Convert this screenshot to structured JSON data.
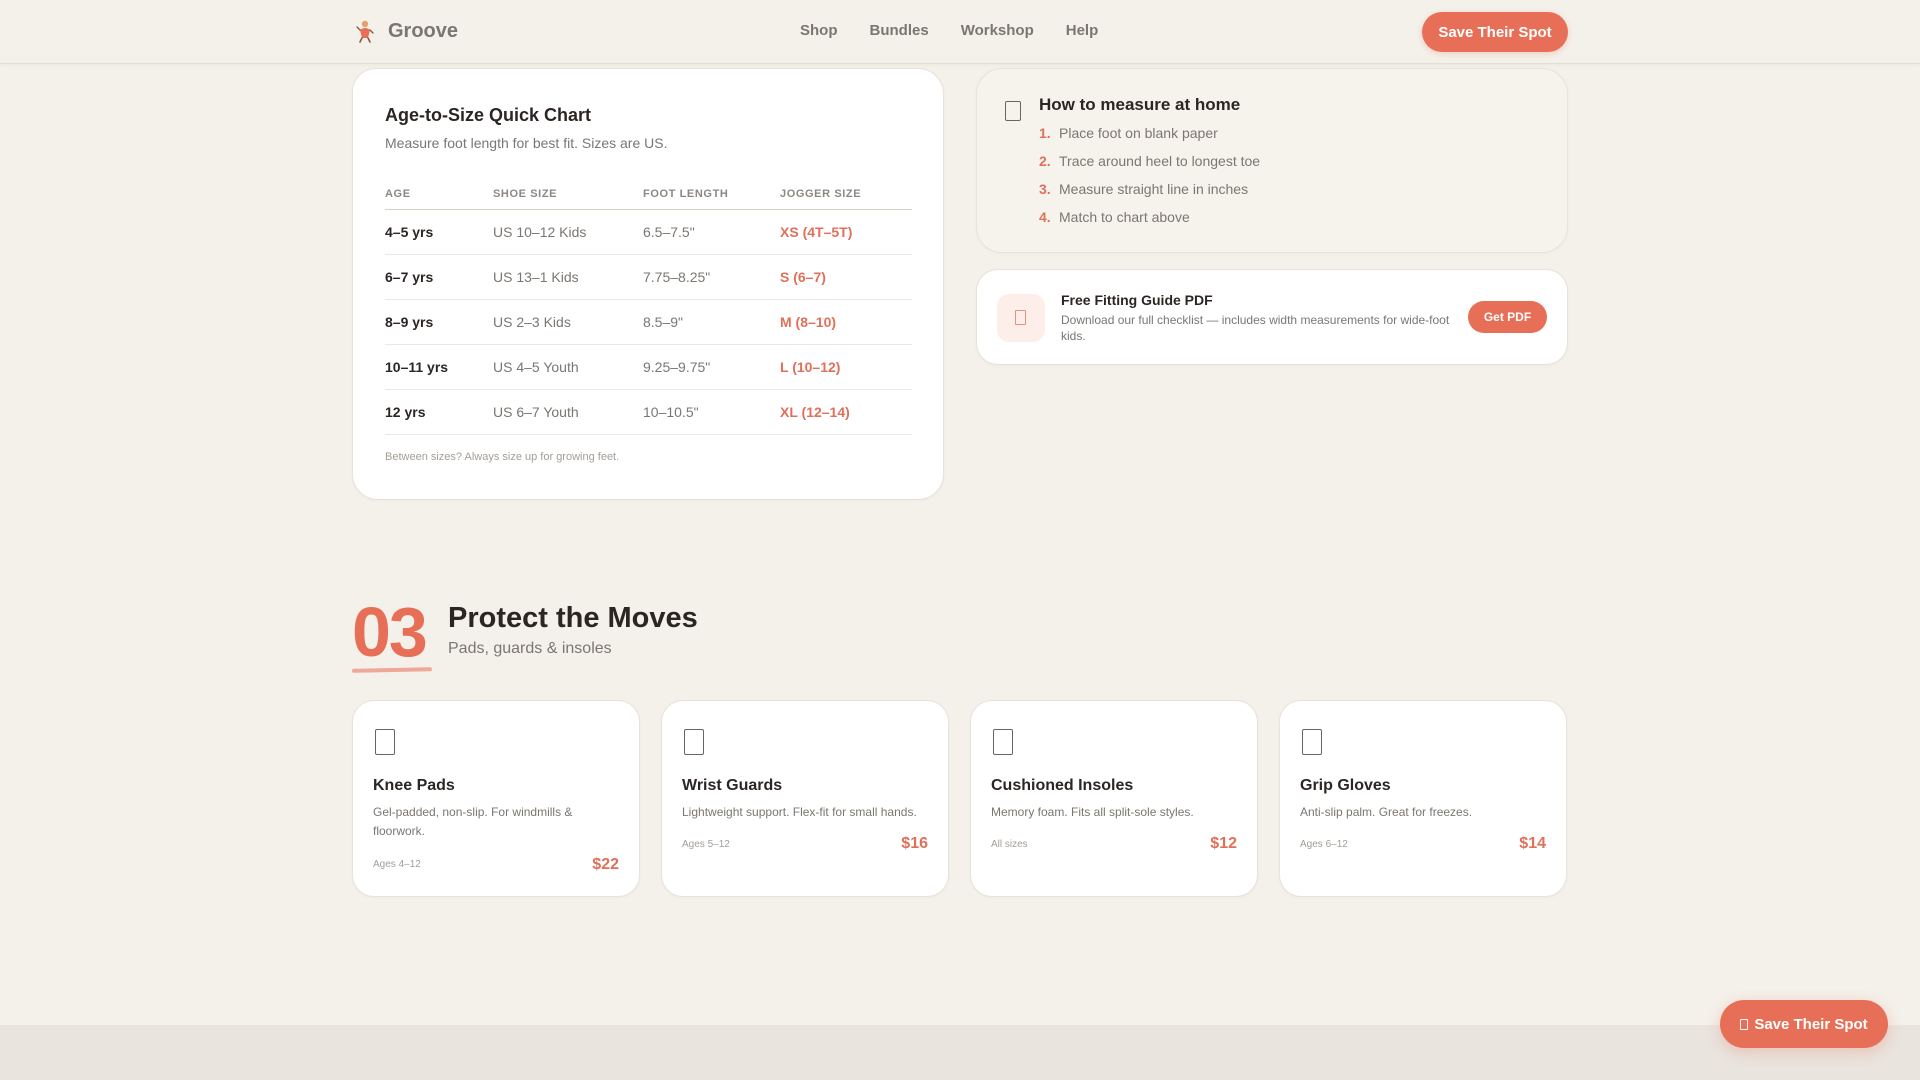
{
  "header": {
    "logo_text": "Groove",
    "logo_icon": "dancer-logo-icon",
    "nav": [
      "Shop",
      "Bundles",
      "Workshop",
      "Help"
    ],
    "cta_label": "Save Their Spot"
  },
  "size_chart": {
    "title": "Age-to-Size Quick Chart",
    "subtitle": "Measure foot length for best fit. Sizes are US.",
    "columns": [
      "AGE",
      "SHOE SIZE",
      "FOOT LENGTH",
      "JOGGER SIZE"
    ],
    "rows": [
      {
        "age": "4–5 yrs",
        "shoe": "US 10–12 Kids",
        "foot": "6.5–7.5\"",
        "jogger": "XS (4T–5T)"
      },
      {
        "age": "6–7 yrs",
        "shoe": "US 13–1 Kids",
        "foot": "7.75–8.25\"",
        "jogger": "S (6–7)"
      },
      {
        "age": "8–9 yrs",
        "shoe": "US 2–3 Kids",
        "foot": "8.5–9\"",
        "jogger": "M (8–10)"
      },
      {
        "age": "10–11 yrs",
        "shoe": "US 4–5 Youth",
        "foot": "9.25–9.75\"",
        "jogger": "L (10–12)"
      },
      {
        "age": "12 yrs",
        "shoe": "US 6–7 Youth",
        "foot": "10–10.5\"",
        "jogger": "XL (12–14)"
      }
    ],
    "note": "Between sizes? Always size up for growing feet."
  },
  "measure": {
    "title": "How to measure at home",
    "icon": "ruler-icon",
    "steps": [
      {
        "num": "1.",
        "text": "Place foot on blank paper"
      },
      {
        "num": "2.",
        "text": "Trace around heel to longest toe"
      },
      {
        "num": "3.",
        "text": "Measure straight line in inches"
      },
      {
        "num": "4.",
        "text": "Match to chart above"
      }
    ]
  },
  "pdf": {
    "title": "Free Fitting Guide PDF",
    "description": "Download our full checklist — includes width measurements for wide-foot kids.",
    "button_label": "Get PDF",
    "icon": "document-icon"
  },
  "section": {
    "number": "03",
    "title": "Protect the Moves",
    "subtitle": "Pads, guards & insoles"
  },
  "products": [
    {
      "name": "Knee Pads",
      "description": "Gel-padded, non-slip. For windmills & floorwork.",
      "ages": "Ages 4–12",
      "price": "$22",
      "icon": "knee-pad-icon"
    },
    {
      "name": "Wrist Guards",
      "description": "Lightweight support. Flex-fit for small hands.",
      "ages": "Ages 5–12",
      "price": "$16",
      "icon": "wrist-guard-icon"
    },
    {
      "name": "Cushioned Insoles",
      "description": "Memory foam. Fits all split-sole styles.",
      "ages": "All sizes",
      "price": "$12",
      "icon": "insole-icon"
    },
    {
      "name": "Grip Gloves",
      "description": "Anti-slip palm. Great for freezes.",
      "ages": "Ages 6–12",
      "price": "$14",
      "icon": "glove-icon"
    }
  ],
  "floating_cta": {
    "label": "Save Their Spot",
    "icon": "ticket-icon"
  },
  "colors": {
    "accent": "#e86f57",
    "background": "#f4f0ea",
    "text": "#2b2623",
    "muted": "#7b7671"
  }
}
